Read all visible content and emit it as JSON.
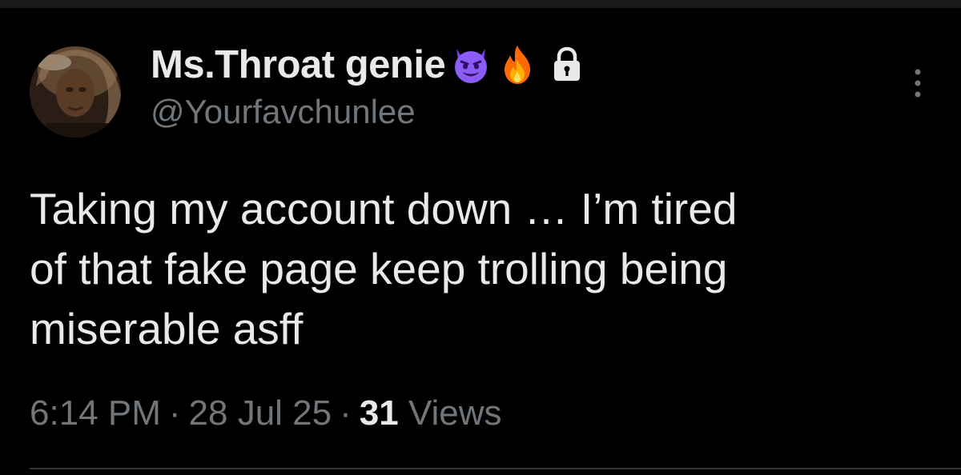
{
  "tweet": {
    "author": {
      "display_name": "Ms.Throat genie",
      "handle": "@Yourfavchunlee",
      "badges": [
        "smiling-devil-emoji",
        "fire-emoji",
        "lock-icon"
      ]
    },
    "text_lines": [
      "Taking my account down … I’m tired",
      "of that fake page keep trolling being",
      "miserable asff"
    ],
    "meta": {
      "time": "6:14 PM",
      "separator": "·",
      "date": "28 Jul 25",
      "views_count": "31",
      "views_label": "Views"
    }
  },
  "icons": {
    "more": "more-vertical-icon",
    "avatar": "profile-avatar"
  },
  "colors": {
    "background": "#000000",
    "primary_text": "#e7e9ea",
    "secondary_text": "#71767b",
    "divider": "#2f3336",
    "devil_purple": "#8b5cf6",
    "fire_orange": "#ff6a00"
  }
}
